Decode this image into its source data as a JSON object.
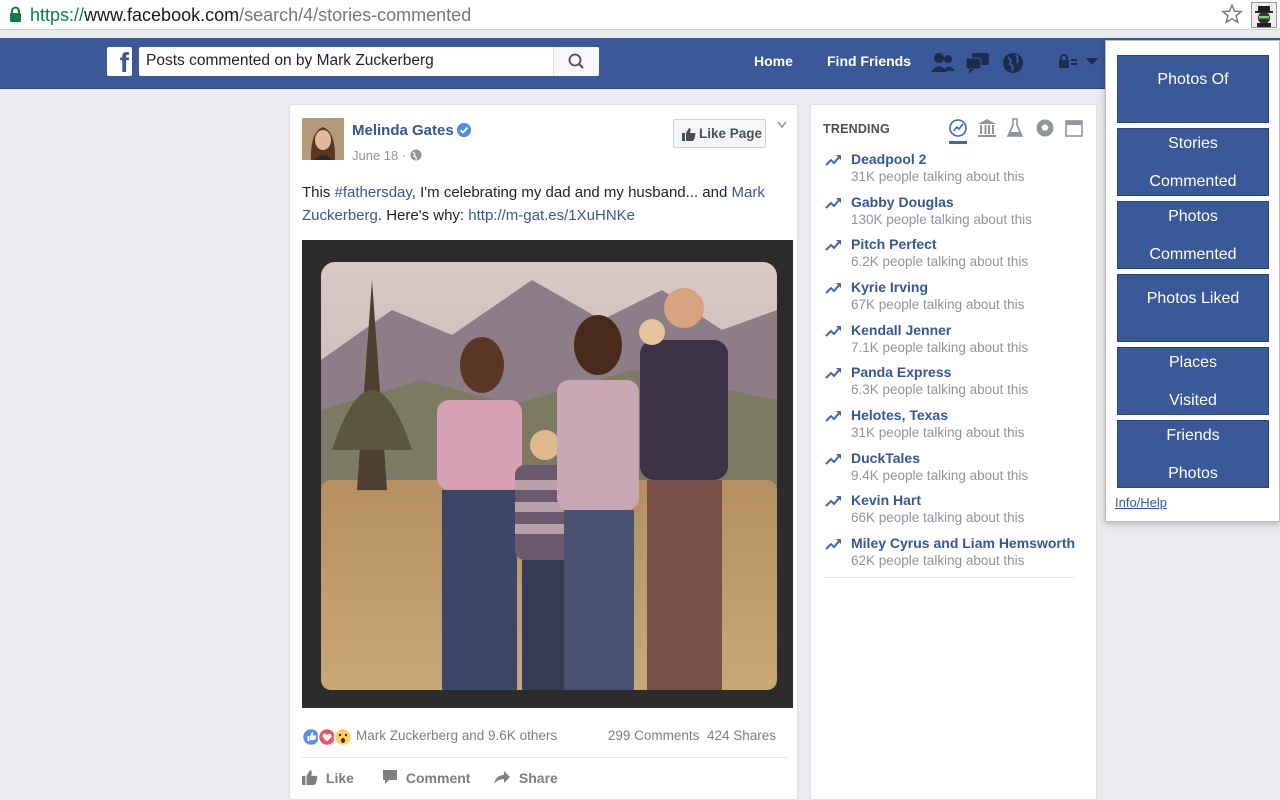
{
  "browser": {
    "url_scheme": "https://",
    "url_host": "www.facebook.com",
    "url_path": "/search/4/stories-commented"
  },
  "header": {
    "search_value": "Posts commented on by Mark Zuckerberg",
    "nav_home": "Home",
    "nav_find_friends": "Find Friends"
  },
  "post": {
    "author": "Melinda Gates",
    "date": "June 18 · ",
    "like_page": "Like Page",
    "text_1": "This ",
    "hashtag": "#fathersday",
    "text_2": ", I'm celebrating my dad and my husband... and ",
    "mention": "Mark Zuckerberg",
    "text_3": ". Here's why: ",
    "link": "http://m-gat.es/1XuHNKe",
    "reactions_text": "Mark Zuckerberg and 9.6K others",
    "comments": "299 Comments",
    "shares": "424 Shares",
    "actions": {
      "like": "Like",
      "comment": "Comment",
      "share": "Share"
    }
  },
  "trending": {
    "heading": "TRENDING",
    "items": [
      {
        "name": "Deadpool 2",
        "sub": "31K people talking about this"
      },
      {
        "name": "Gabby Douglas",
        "sub": "130K people talking about this"
      },
      {
        "name": "Pitch Perfect",
        "sub": "6.2K people talking about this"
      },
      {
        "name": "Kyrie Irving",
        "sub": "67K people talking about this"
      },
      {
        "name": "Kendall Jenner",
        "sub": "7.1K people talking about this"
      },
      {
        "name": "Panda Express",
        "sub": "6.3K people talking about this"
      },
      {
        "name": "Helotes, Texas",
        "sub": "31K people talking about this"
      },
      {
        "name": "DuckTales",
        "sub": "9.4K people talking about this"
      },
      {
        "name": "Kevin Hart",
        "sub": "66K people talking about this"
      },
      {
        "name": "Miley Cyrus and Liam Hemsworth",
        "sub": "62K people talking about this"
      }
    ]
  },
  "popup": {
    "buttons": [
      {
        "l1": "Photos Of",
        "l2": ""
      },
      {
        "l1": "Stories",
        "l2": "Commented"
      },
      {
        "l1": "Photos",
        "l2": "Commented"
      },
      {
        "l1": "Photos Liked",
        "l2": ""
      },
      {
        "l1": "Places",
        "l2": "Visited"
      },
      {
        "l1": "Friends",
        "l2": "Photos"
      }
    ],
    "help": "Info/Help"
  },
  "colors": {
    "fb_blue": "#3b5998",
    "link": "#365899",
    "bg": "#e9ebee"
  }
}
